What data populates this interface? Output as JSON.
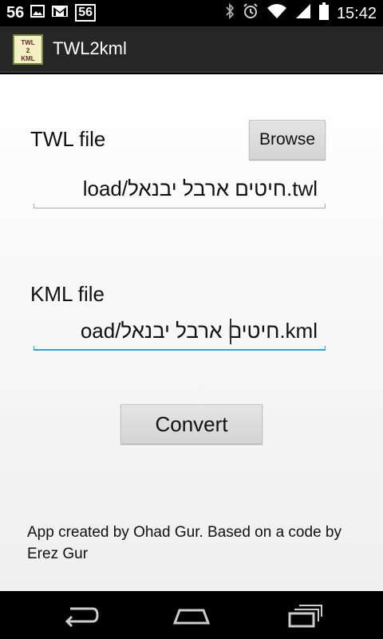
{
  "status_bar": {
    "notif_1": "56",
    "notif_badge": "56",
    "time": "15:42",
    "icons": [
      "image-icon",
      "gmail-icon",
      "bluetooth-icon",
      "alarm-icon",
      "wifi-icon",
      "signal-icon",
      "battery-icon"
    ]
  },
  "action_bar": {
    "title": "TWL2kml",
    "icon_text": [
      "TWL",
      "2",
      "KML"
    ]
  },
  "form": {
    "twl_label": "TWL file",
    "browse_label": "Browse",
    "twl_value": "load/חיטים ארבל יבנאל.twl",
    "kml_label": "KML file",
    "kml_value": "oad/חיטים ארבל יבנאל.kml",
    "convert_label": "Convert"
  },
  "footer": {
    "credit": "App created by Ohad Gur. Based on a code by Erez Gur"
  },
  "nav_bar": {
    "icons": [
      "back-icon",
      "home-icon",
      "recents-icon"
    ]
  },
  "colors": {
    "accent": "#33a5d6",
    "action_bar": "#262626"
  }
}
